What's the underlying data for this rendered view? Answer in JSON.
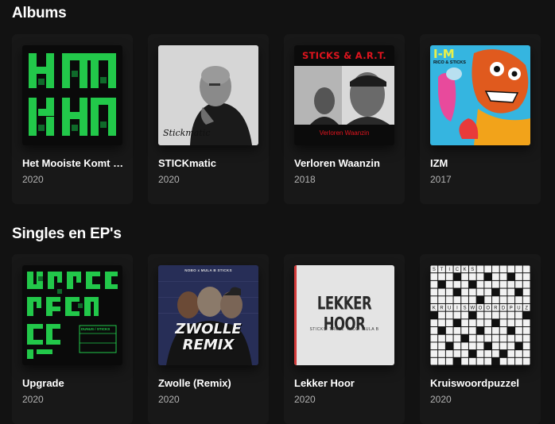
{
  "albums": {
    "heading": "Albums",
    "items": [
      {
        "title": "Het Mooiste Komt Nog",
        "year": "2020",
        "cover_text": "HMKN"
      },
      {
        "title": "STICKmatic",
        "year": "2020",
        "cover_text": "Stickmatic"
      },
      {
        "title": "Verloren Waanzin",
        "year": "2018",
        "cover_top": "STICKS & A.R.T.",
        "cover_bottom": "Verloren Waanzin"
      },
      {
        "title": "IZM",
        "year": "2017",
        "cover_text": "I-M",
        "cover_sub": "RICO & STICKS"
      }
    ]
  },
  "singles": {
    "heading": "Singles en EP's",
    "items": [
      {
        "title": "Upgrade",
        "year": "2020",
        "cover_text": "UPGRADE",
        "cover_tag": "DUNUS / STICKS"
      },
      {
        "title": "Zwolle (Remix)",
        "year": "2020",
        "cover_text": "ZWOLLE",
        "cover_sub": "REMIX",
        "cover_top": "NOBO x MULA B STICKS"
      },
      {
        "title": "Lekker Hoor",
        "year": "2020",
        "cover_text": "LEKKER HOOR",
        "cover_sub": "STICKS  TREEZ  RICO  MULA B"
      },
      {
        "title": "Kruiswoordpuzzel",
        "year": "2020",
        "cover_text": "KRUISWOORDPUZZEL",
        "cover_top": "STICKS"
      }
    ]
  },
  "colors": {
    "background": "#121212",
    "card": "#181818",
    "muted_text": "#b3b3b3",
    "green": "#1ed760"
  }
}
